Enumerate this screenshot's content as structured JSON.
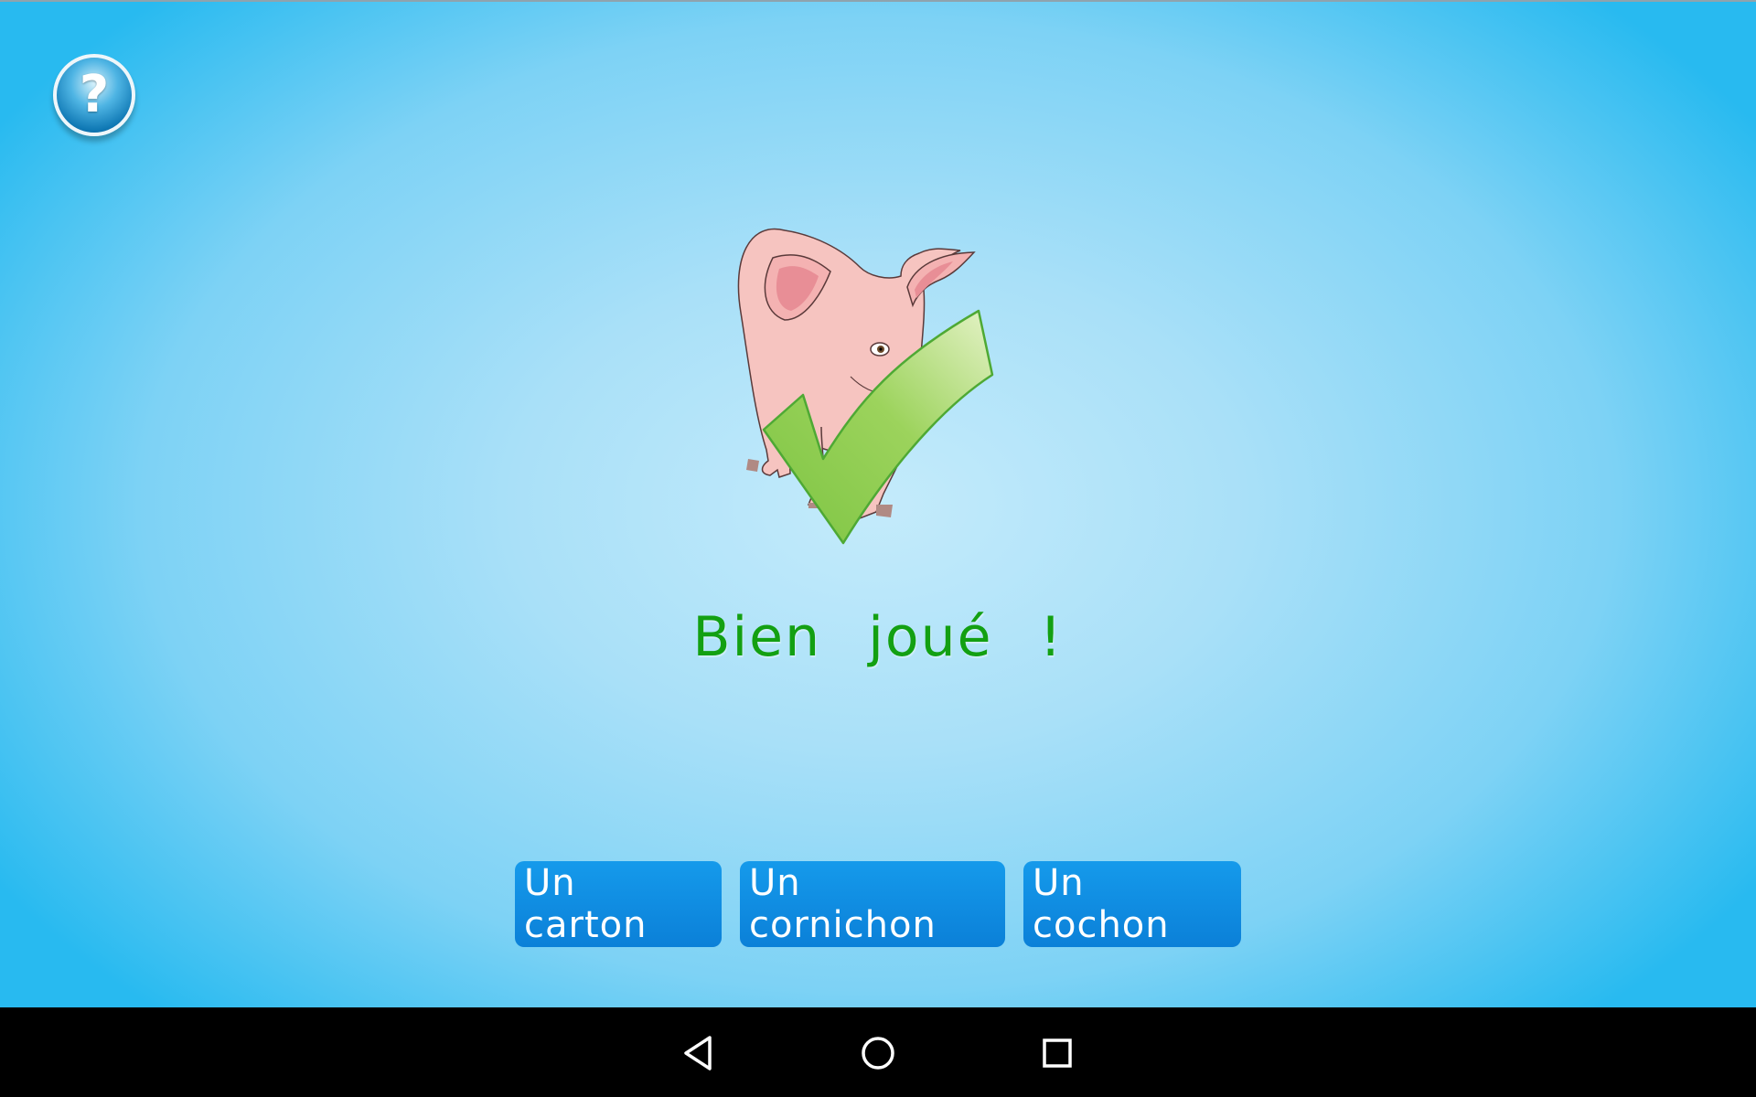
{
  "help": {
    "icon": "question-mark-icon",
    "glyph": "?"
  },
  "illustration": {
    "subject": "pig-icon",
    "badge": "check-icon"
  },
  "feedback": {
    "message": "Bien joué !"
  },
  "answers": [
    {
      "label": "Un carton"
    },
    {
      "label": "Un cornichon"
    },
    {
      "label": "Un cochon"
    }
  ],
  "navbar": {
    "back": "back-triangle-icon",
    "home": "home-circle-icon",
    "recents": "recents-square-icon"
  },
  "colors": {
    "feedback_text": "#13a012",
    "answer_button": "#0b80d8",
    "background_center": "#c4ebfb",
    "background_edge": "#28baf0"
  }
}
